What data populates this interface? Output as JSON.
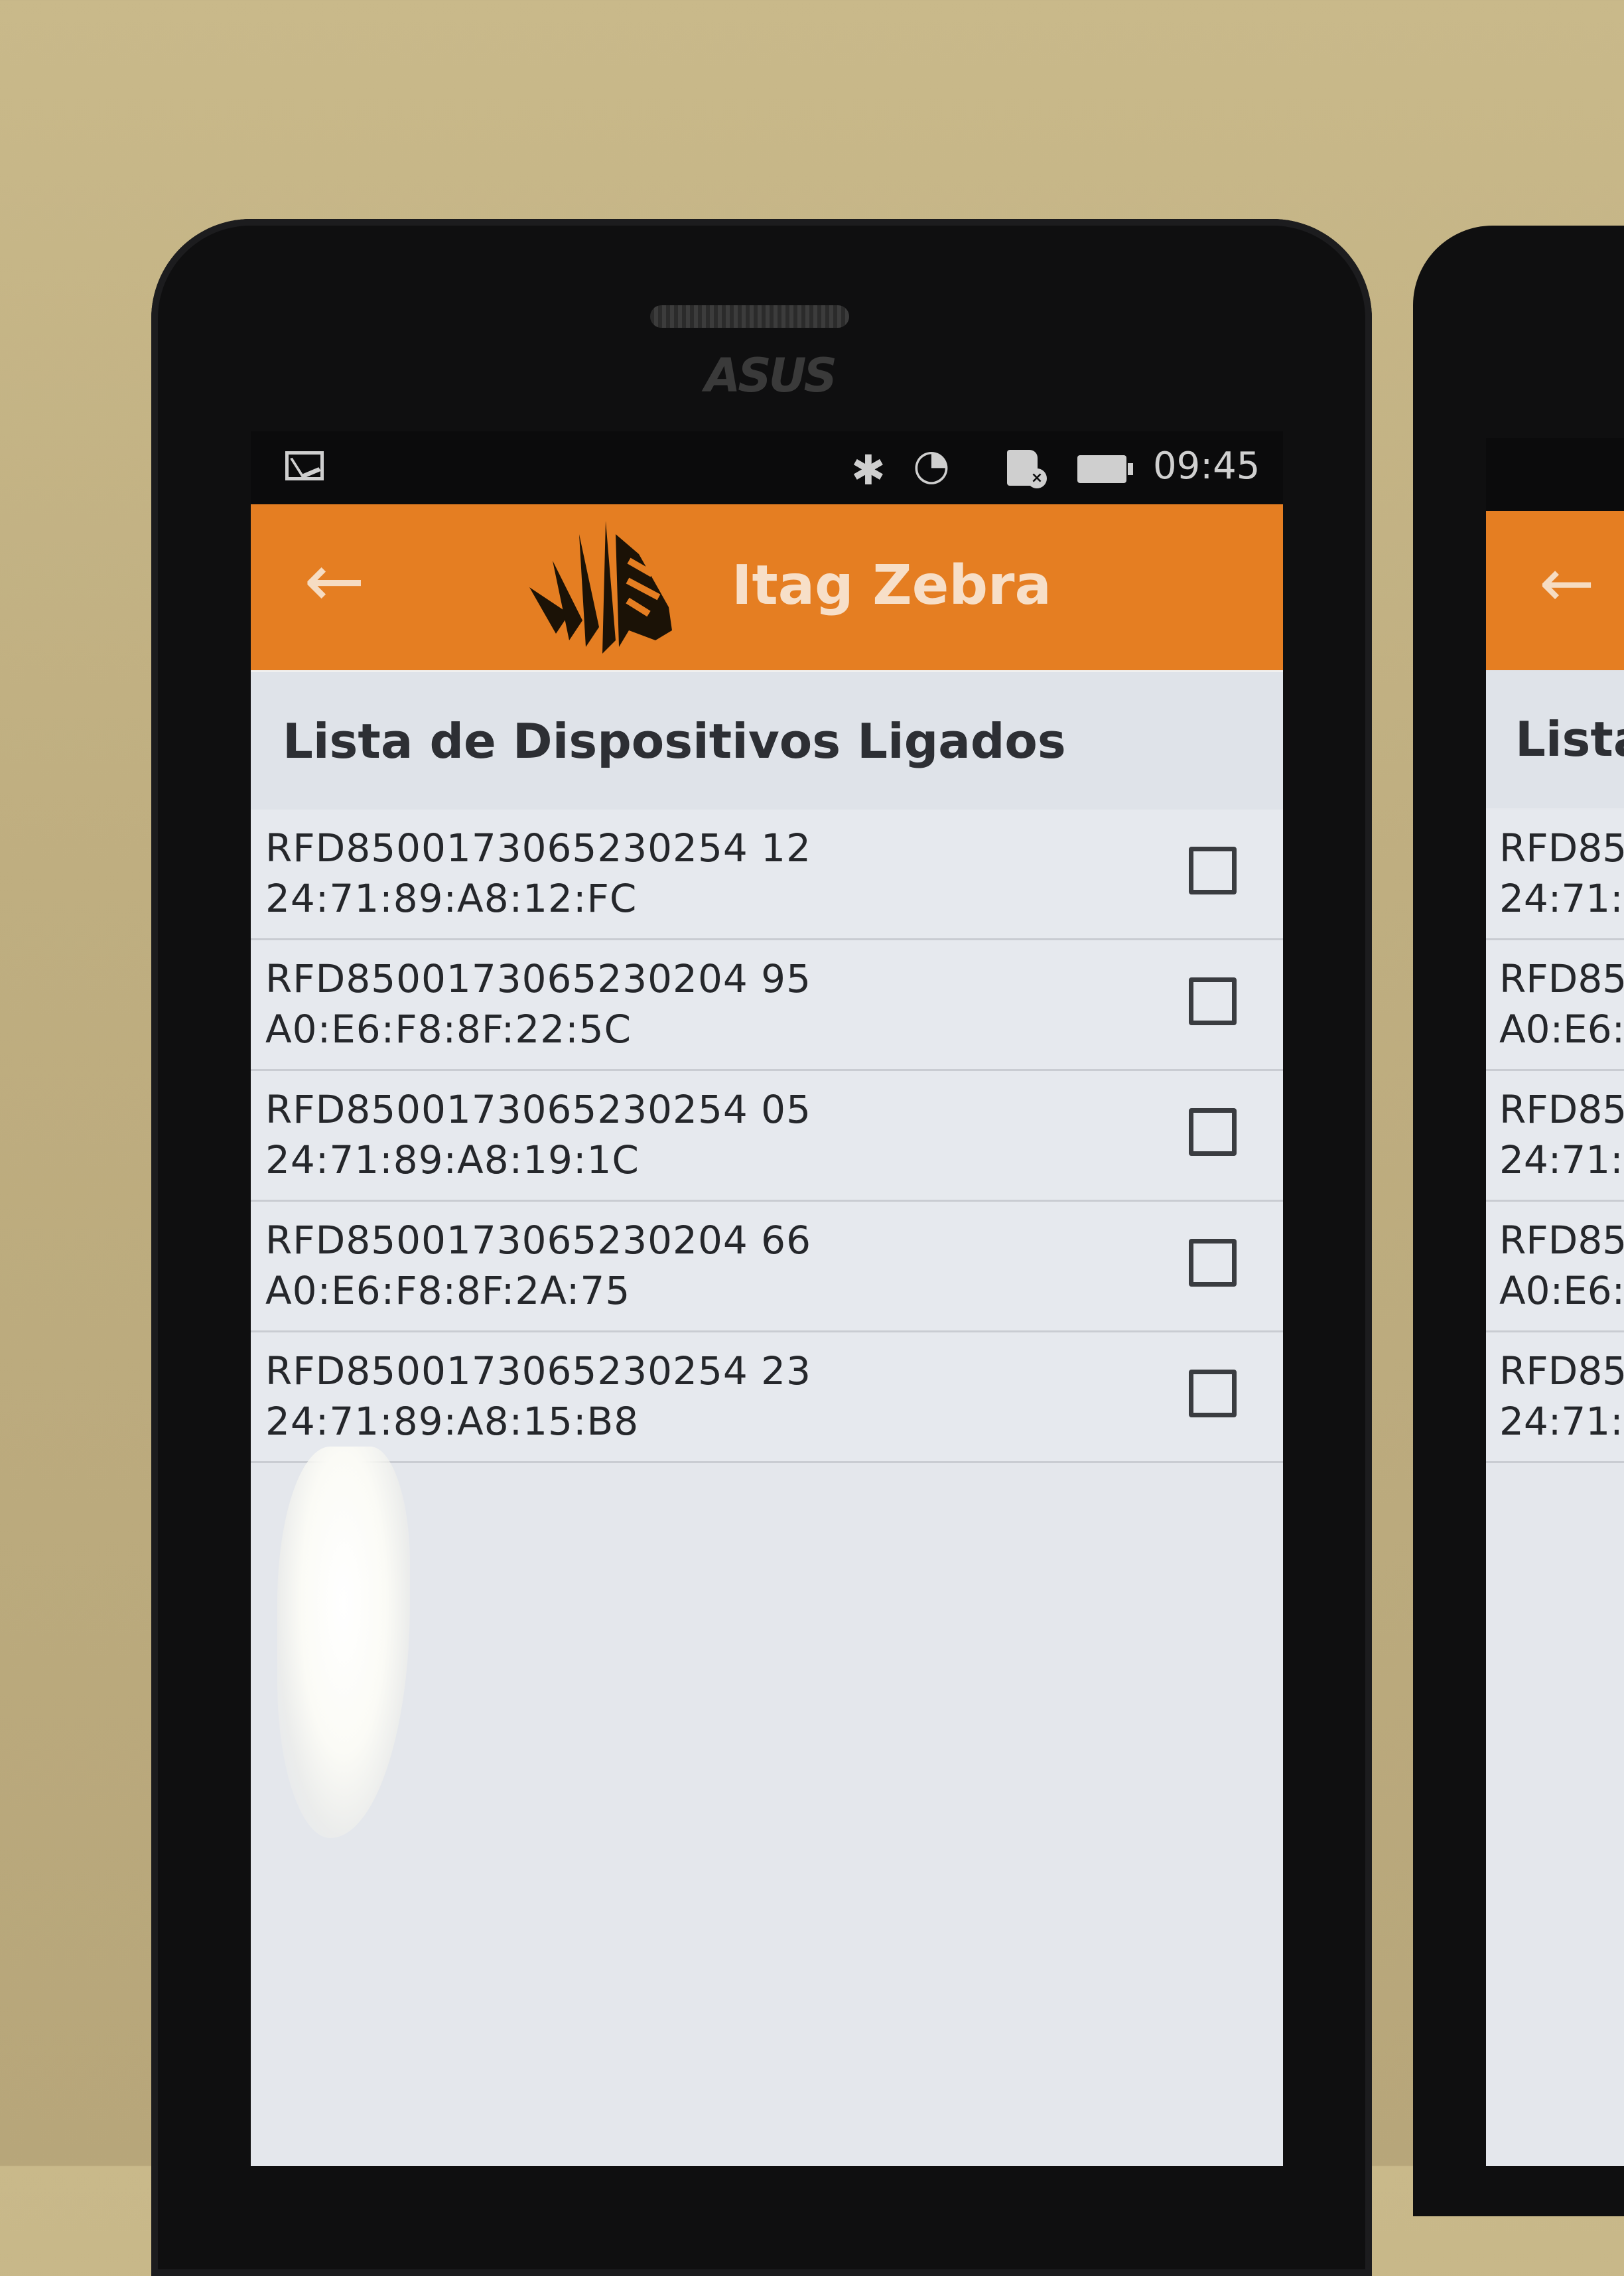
{
  "status_bar": {
    "time": "09:45",
    "icons": [
      "gmail-icon",
      "bluetooth-icon",
      "wifi-icon",
      "sd-card-error-icon",
      "battery-icon"
    ]
  },
  "device_brand": "ASUS",
  "app_bar": {
    "title": "Itag Zebra",
    "back_icon": "arrow-left-icon",
    "logo": "zebra-logo"
  },
  "list": {
    "title": "Lista de Dispositivos Ligados",
    "devices": [
      {
        "name": "RFD8500173065230254 12",
        "mac": "24:71:89:A8:12:FC",
        "checked": false
      },
      {
        "name": "RFD8500173065230204 95",
        "mac": "A0:E6:F8:8F:22:5C",
        "checked": false
      },
      {
        "name": "RFD8500173065230254 05",
        "mac": "24:71:89:A8:19:1C",
        "checked": false
      },
      {
        "name": "RFD8500173065230204 66",
        "mac": "A0:E6:F8:8F:2A:75",
        "checked": false
      },
      {
        "name": "RFD8500173065230254 23",
        "mac": "24:71:89:A8:15:B8",
        "checked": false
      }
    ]
  },
  "second_phone": {
    "title": "Lista",
    "rows": [
      {
        "a": "RFD85",
        "b": "24:71:"
      },
      {
        "a": "RFD85",
        "b": "A0:E6:"
      },
      {
        "a": "RFD85",
        "b": "24:71:"
      },
      {
        "a": "RFD85",
        "b": "A0:E6:"
      },
      {
        "a": "RFD85",
        "b": "24:71:"
      }
    ]
  },
  "colors": {
    "accent": "#e57e22",
    "screen_bg": "#e4e7ec",
    "text": "#25272b"
  }
}
